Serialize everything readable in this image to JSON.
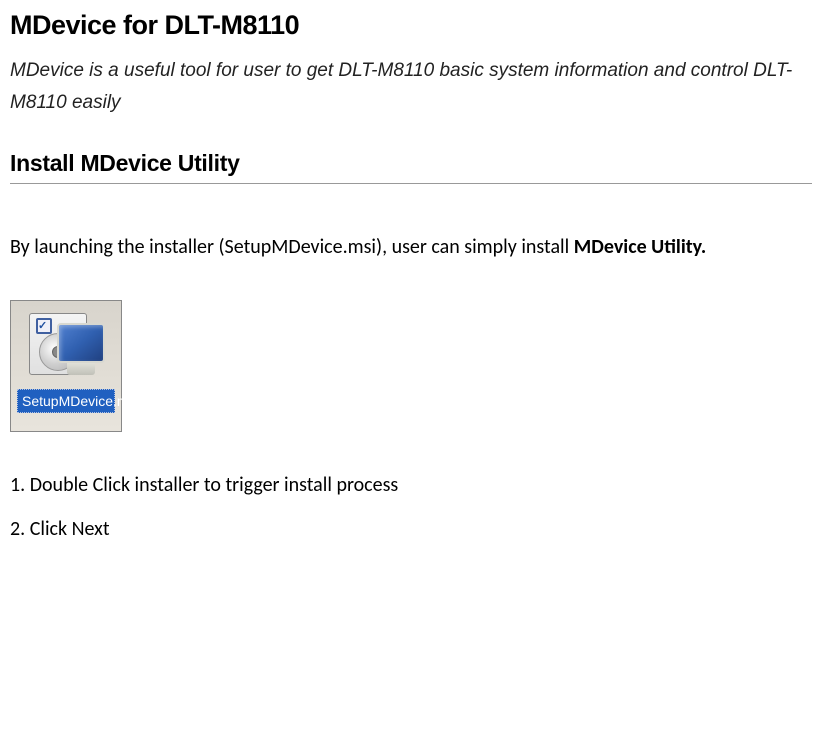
{
  "title": "MDevice for DLT-M8110",
  "intro": "MDevice is a useful tool for user to get DLT-M8110 basic system information and control DLT-M8110 easily",
  "sectionHeading": "Install MDevice Utility",
  "bodyPrefix": "By launching the installer (SetupMDevice.msi), user can simply install ",
  "bodySuffix": "MDevice Utility.",
  "installer": {
    "iconLabel": "SetupMDevice.msi"
  },
  "steps": [
    "1. Double Click installer to trigger install process",
    "2. Click Next"
  ]
}
